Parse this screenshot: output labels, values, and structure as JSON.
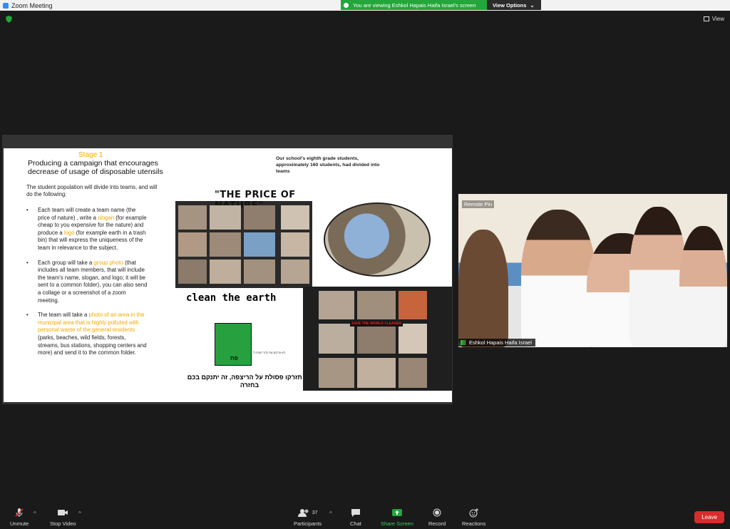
{
  "window": {
    "title": "Zoom Meeting"
  },
  "share_banner": {
    "text": "You are viewing Eshkol Hapais Haifa Israel's screen",
    "view_options": "View Options"
  },
  "top_right": {
    "view_label": "View"
  },
  "slide": {
    "stage": "Stage 1",
    "title": "Producing a campaign that encourages decrease of usage of disposable utensils",
    "intro": "The student population will divide into teams, and will do the following:",
    "bullet1_a": "Each team will create a team name (the price of nature) , write a ",
    "bullet1_slogan": "slogan",
    "bullet1_b": " (for example cheap to you expensive for the nature) and produce a ",
    "bullet1_logo": "logo",
    "bullet1_c": " (for example earth in a trash bin) that will express the uniqueness of the team in relevance to the subject.",
    "bullet2_a": "Each group will take a ",
    "bullet2_photo": "group photo",
    "bullet2_b": " (that includes all team members, that will include the team's name, slogan, and logo; it will be sent to a common folder), you can also send a collage or a screenshot of a zoom meeting.",
    "bullet3_a": "The team will take a ",
    "bullet3_hl": "photo of an area in the municipal area that is highly polluted with personal waste of the general residents",
    "bullet3_b": " (parks, beaches, wild fields, forests, streams, bus stations, shopping centers and more) and send it to the common folder.",
    "note": "Our school's eighth grade students, approximately 160 students, had divided into teams",
    "collage_title": "\"THE PRICE OF NATURE\"",
    "clean_text": "clean the earth",
    "bin_label": "פח",
    "heb_small": "לא זורקים את כדור הארץ ל-",
    "heb_big": "אל תזרקו פסולת על הריצפה, זה יתנקם בכם בחזרה",
    "collage2_banner": "SAVE THE WORLD CLEANER"
  },
  "video": {
    "remote_tag": "Remote Pin",
    "participant_name": "Eshkol Hapais Haifa Israel"
  },
  "toolbar": {
    "unmute": "Unmute",
    "stop_video": "Stop Video",
    "participants": "Participants",
    "participants_count": "37",
    "chat": "Chat",
    "share_screen": "Share Screen",
    "record": "Record",
    "reactions": "Reactions",
    "leave": "Leave"
  },
  "colors": {
    "accent_green": "#23a63a",
    "highlight": "#f5a800",
    "leave_red": "#d92c2c"
  }
}
